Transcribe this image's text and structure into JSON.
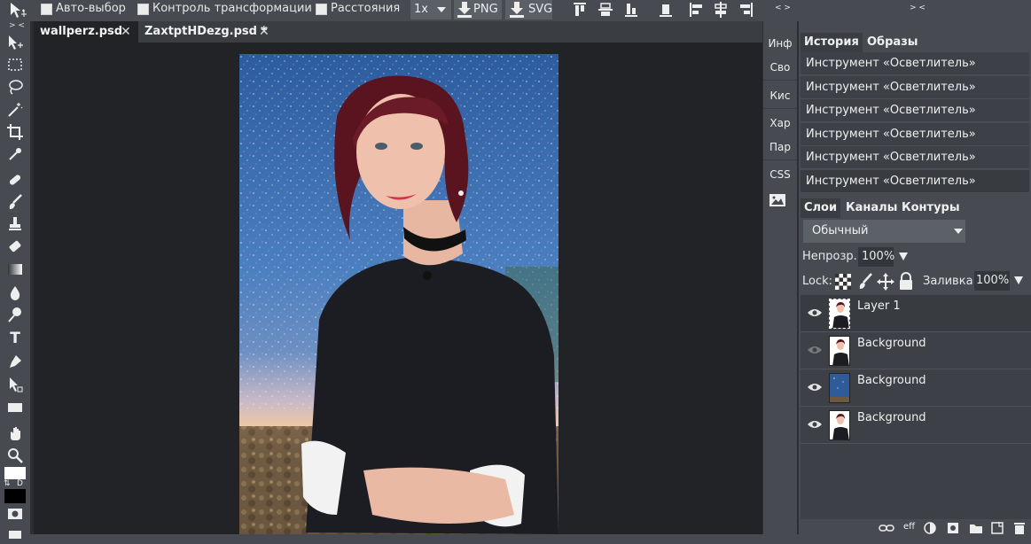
{
  "options_bar": {
    "auto_select": "Авто-выбор",
    "transform_controls": "Контроль трансформации",
    "distances": "Расстояния",
    "zoom_value": "1x",
    "png_label": "PNG",
    "svg_label": "SVG"
  },
  "collapse_glyph": "> <",
  "expand_glyph": "< >",
  "tabs": [
    {
      "label": "wallperz.psd",
      "close": "✕"
    },
    {
      "label": "ZaxtptHDezg.psd *",
      "close": "✕"
    }
  ],
  "toolbar": {
    "text_tool": "T",
    "swap_colors": "⇅",
    "default_colors": "D"
  },
  "mini_panel": {
    "items": [
      "Инф",
      "Сво",
      "Кис",
      "Хар",
      "Пар",
      "CSS"
    ]
  },
  "history_panel": {
    "tabs": [
      "История",
      "Образы"
    ],
    "items": [
      "Инструмент «Осветлитель»",
      "Инструмент «Осветлитель»",
      "Инструмент «Осветлитель»",
      "Инструмент «Осветлитель»",
      "Инструмент «Осветлитель»",
      "Инструмент «Осветлитель»"
    ]
  },
  "layers_panel": {
    "tabs": [
      "Слои",
      "Каналы",
      "Контуры"
    ],
    "blend_mode": "Обычный",
    "opacity_label": "Непрозр.:",
    "opacity_value": "100%",
    "lock_label": "Lock:",
    "fill_label": "Заливка:",
    "fill_value": "100%",
    "layers": [
      {
        "name": "Layer 1"
      },
      {
        "name": "Background"
      },
      {
        "name": "Background"
      },
      {
        "name": "Background"
      }
    ],
    "footer_eff": "eff"
  },
  "colors": {
    "background": "#474b51",
    "canvas": "#222326",
    "panel_item": "#3d4046"
  }
}
